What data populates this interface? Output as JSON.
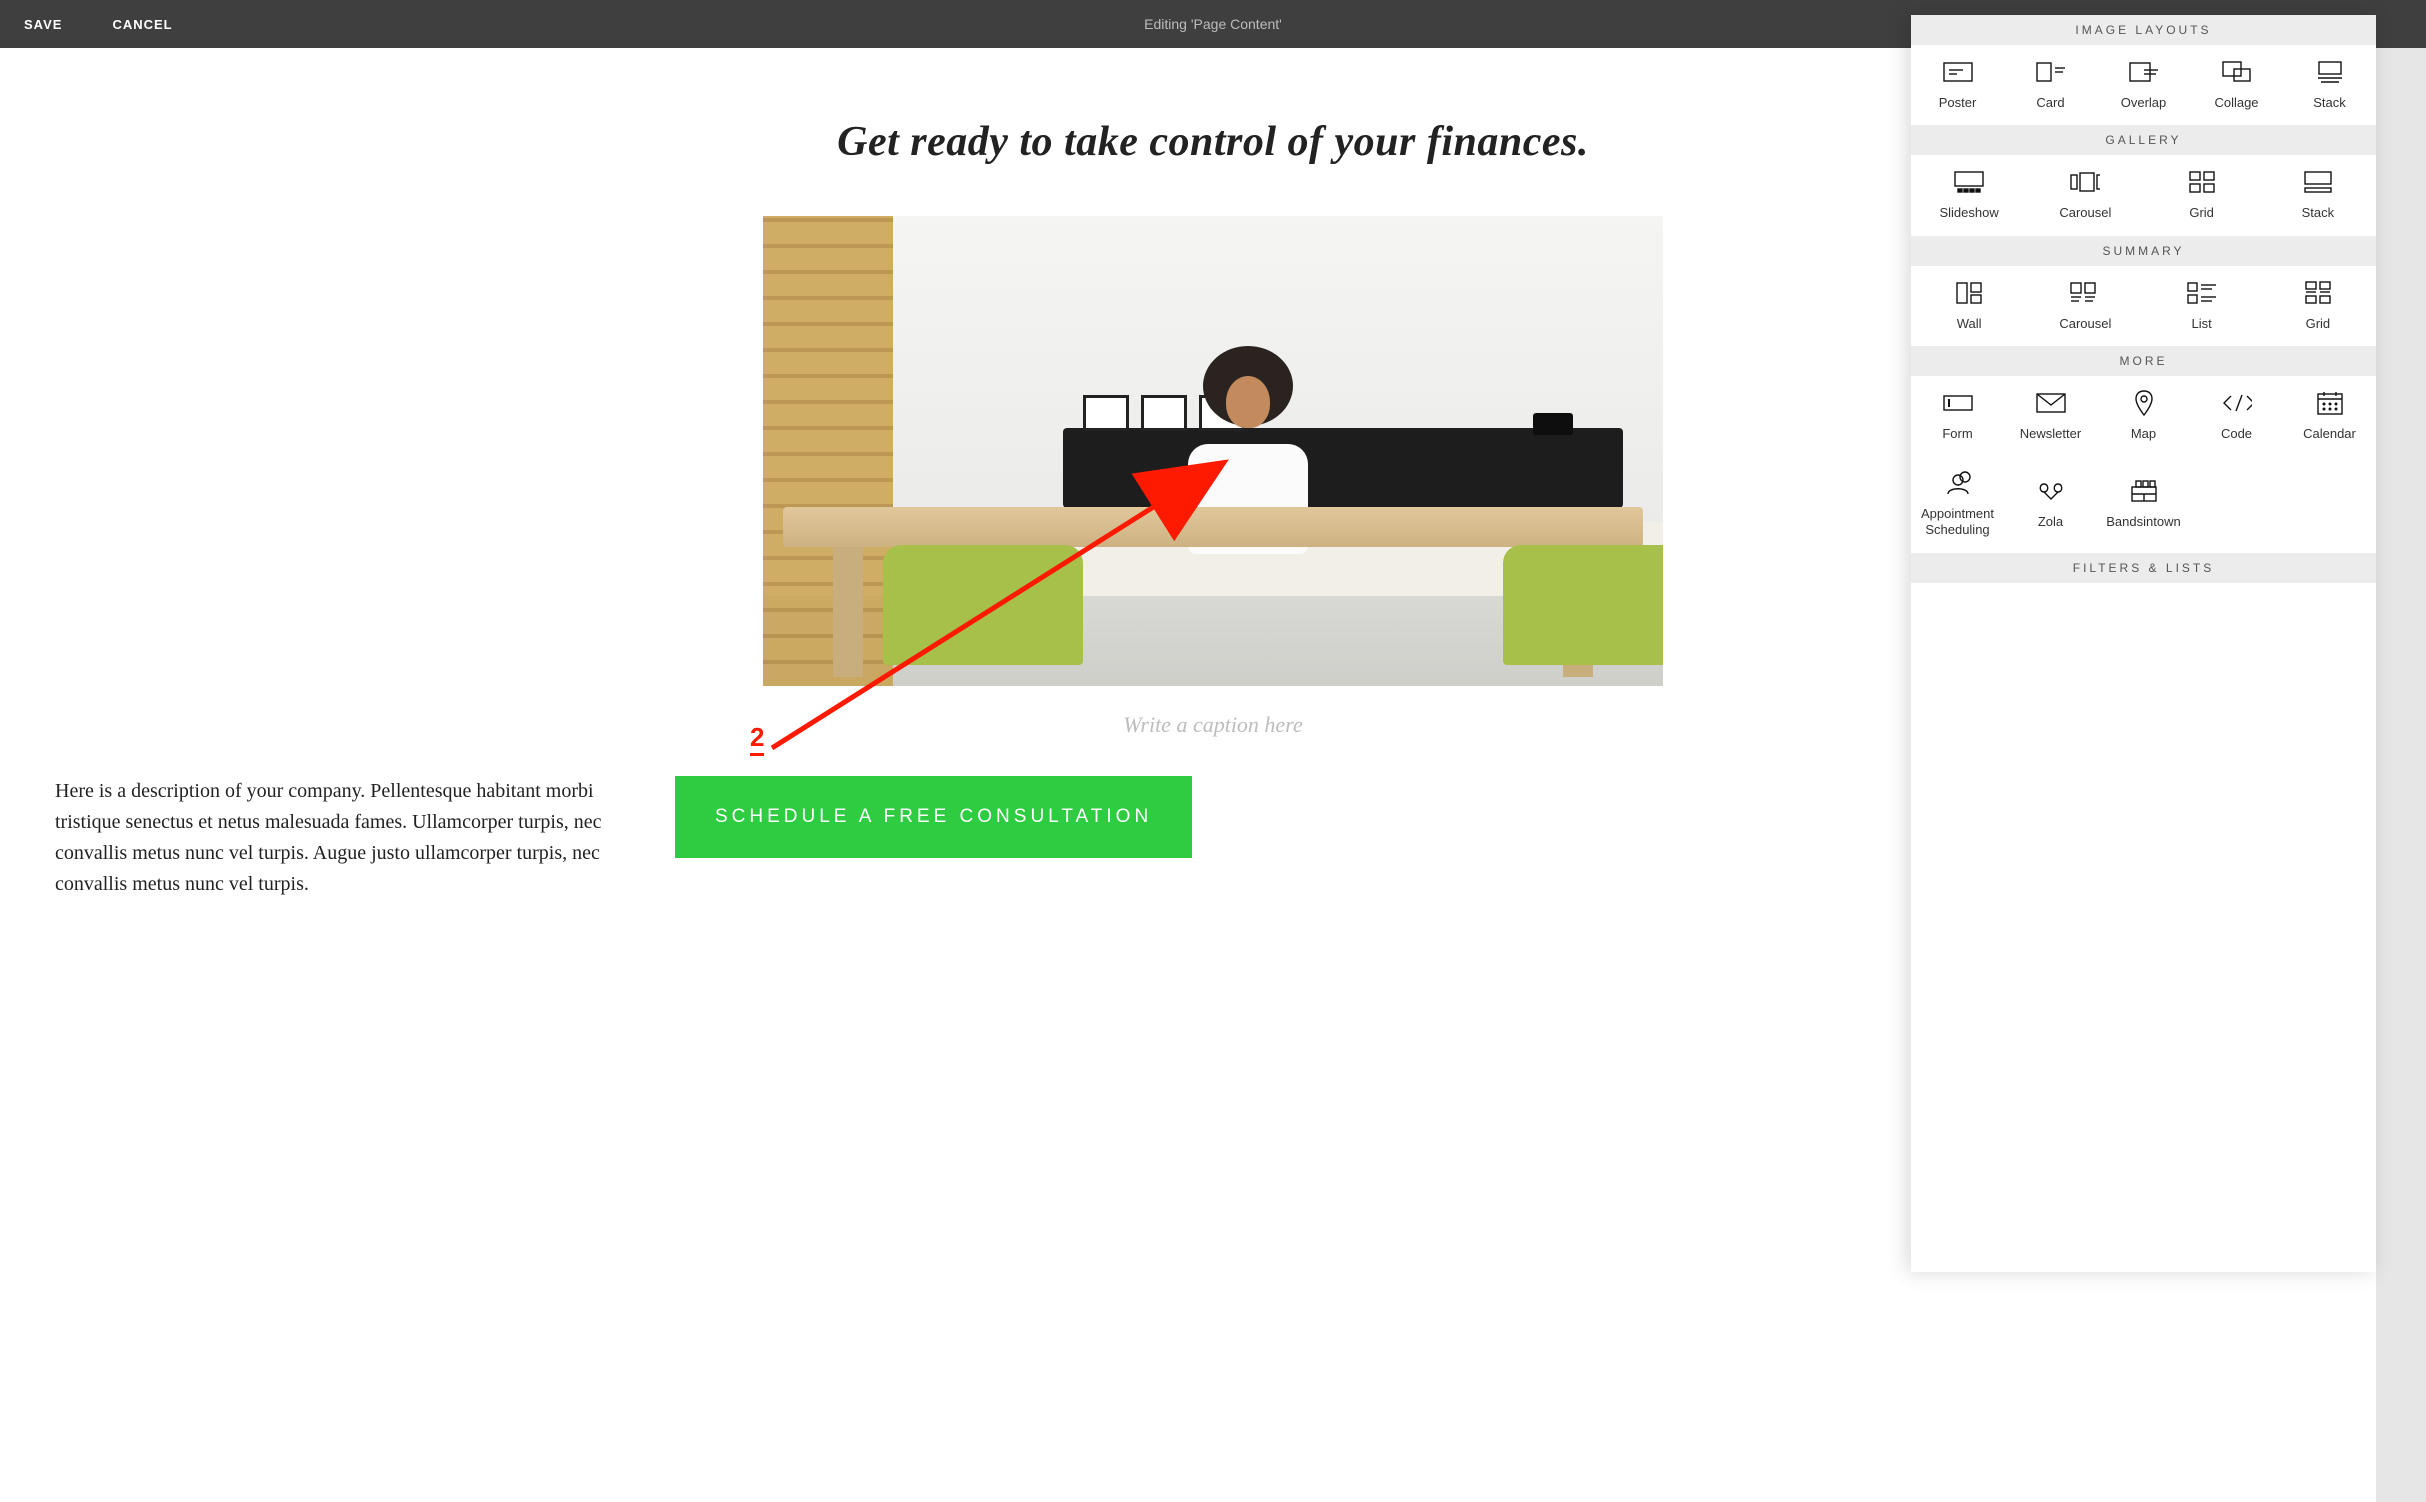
{
  "topbar": {
    "save": "SAVE",
    "cancel": "CANCEL",
    "editing": "Editing 'Page Content'"
  },
  "hero": {
    "title": "Get ready to take control of your finances.",
    "caption_placeholder": "Write a caption here"
  },
  "body": {
    "text": "Here is a description of your company. Pellentesque habitant morbi tristique senectus et netus malesuada fames. Ullamcorper turpis, nec convallis metus nunc vel turpis. Augue justo ullamcorper turpis, nec convallis metus nunc vel turpis.",
    "cta": "SCHEDULE A FREE CONSULTATION"
  },
  "panel": {
    "sections": {
      "image_layouts": {
        "title": "IMAGE LAYOUTS",
        "items": [
          "Poster",
          "Card",
          "Overlap",
          "Collage",
          "Stack"
        ]
      },
      "gallery": {
        "title": "GALLERY",
        "items": [
          "Slideshow",
          "Carousel",
          "Grid",
          "Stack"
        ]
      },
      "summary": {
        "title": "SUMMARY",
        "items": [
          "Wall",
          "Carousel",
          "List",
          "Grid"
        ]
      },
      "more": {
        "title": "MORE",
        "items": [
          "Form",
          "Newsletter",
          "Map",
          "Code",
          "Calendar",
          "Appointment Scheduling",
          "Zola",
          "Bandsintown"
        ]
      },
      "filters": {
        "title": "FILTERS & LISTS"
      }
    }
  },
  "annotation": {
    "number": "2"
  }
}
